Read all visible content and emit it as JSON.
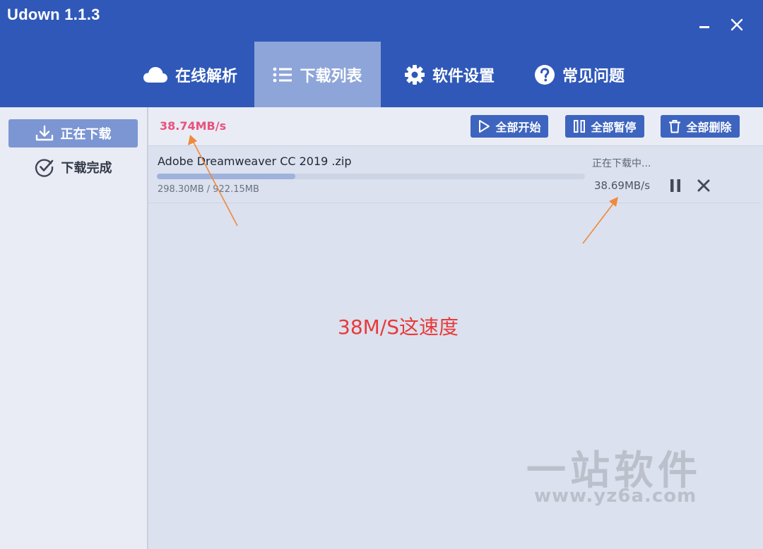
{
  "window": {
    "title": "Udown 1.1.3"
  },
  "nav": {
    "tabs": [
      {
        "label": "在线解析",
        "icon": "cloud-icon"
      },
      {
        "label": "下载列表",
        "icon": "list-icon",
        "active": true
      },
      {
        "label": "软件设置",
        "icon": "gear-icon"
      },
      {
        "label": "常见问题",
        "icon": "question-icon"
      }
    ]
  },
  "sidebar": {
    "items": [
      {
        "label": "正在下载",
        "icon": "download-icon",
        "active": true
      },
      {
        "label": "下载完成",
        "icon": "check-circle-icon"
      }
    ]
  },
  "toolbar": {
    "total_speed": "38.74MB/s",
    "start_all_label": "全部开始",
    "pause_all_label": "全部暂停",
    "delete_all_label": "全部删除"
  },
  "downloads": [
    {
      "file_name": "Adobe Dreamweaver CC 2019 .zip",
      "size_text": "298.30MB / 922.15MB",
      "progress": 0.3235,
      "status": "正在下载中...",
      "speed": "38.69MB/s"
    }
  ],
  "annotations": {
    "note": "38M/S这速度",
    "arrow_color": "#f0893a"
  },
  "watermark": {
    "name": "一站软件",
    "url": "www.yz6a.com"
  },
  "colors": {
    "header": "#2f58b8",
    "active_tab": "#8ea5d9",
    "button": "#3d64bf",
    "speed_text": "#e8527e",
    "annotation_text": "#e83a3a"
  }
}
